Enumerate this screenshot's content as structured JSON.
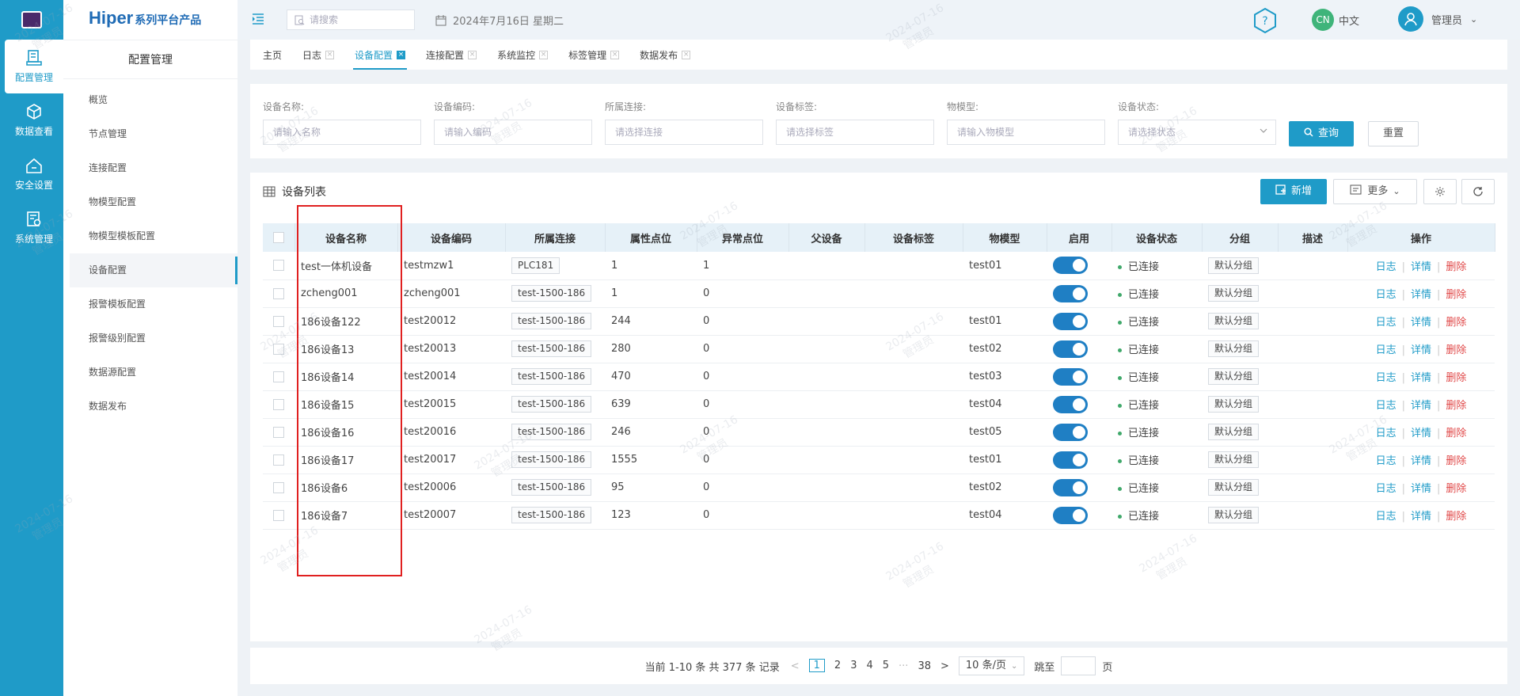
{
  "rail": {
    "items": [
      {
        "label": "配置管理",
        "icon": "device-config-icon"
      },
      {
        "label": "数据查看",
        "icon": "cube-icon"
      },
      {
        "label": "安全设置",
        "icon": "home-shield-icon"
      },
      {
        "label": "系统管理",
        "icon": "system-icon"
      }
    ]
  },
  "sidebar": {
    "brand_main": "Hiper",
    "brand_sub": "系列平台产品",
    "title": "配置管理",
    "items": [
      "概览",
      "节点管理",
      "连接配置",
      "物模型配置",
      "物模型模板配置",
      "设备配置",
      "报警模板配置",
      "报警级别配置",
      "数据源配置",
      "数据发布"
    ],
    "active": "设备配置"
  },
  "header": {
    "search_placeholder": "请搜索",
    "date": "2024年7月16日 星期二",
    "lang_badge": "CN",
    "lang_label": "中文",
    "user": "管理员"
  },
  "tabs": [
    {
      "label": "主页",
      "closable": false
    },
    {
      "label": "日志",
      "closable": true
    },
    {
      "label": "设备配置",
      "closable": true,
      "active": true
    },
    {
      "label": "连接配置",
      "closable": true
    },
    {
      "label": "系统监控",
      "closable": true
    },
    {
      "label": "标签管理",
      "closable": true
    },
    {
      "label": "数据发布",
      "closable": true
    }
  ],
  "filters": {
    "name": {
      "label": "设备名称:",
      "placeholder": "请输入名称"
    },
    "code": {
      "label": "设备编码:",
      "placeholder": "请输入编码"
    },
    "connection": {
      "label": "所属连接:",
      "placeholder": "请选择连接"
    },
    "tag": {
      "label": "设备标签:",
      "placeholder": "请选择标签"
    },
    "model": {
      "label": "物模型:",
      "placeholder": "请输入物模型"
    },
    "status": {
      "label": "设备状态:",
      "placeholder": "请选择状态"
    },
    "query": "查询",
    "reset": "重置"
  },
  "list": {
    "title": "设备列表",
    "new": "新增",
    "more": "更多",
    "columns": [
      "设备名称",
      "设备编码",
      "所属连接",
      "属性点位",
      "异常点位",
      "父设备",
      "设备标签",
      "物模型",
      "启用",
      "设备状态",
      "分组",
      "描述",
      "操作"
    ],
    "rows": [
      {
        "name": "test一体机设备",
        "code": "testmzw1",
        "conn": "PLC181",
        "points": "1",
        "errors": "1",
        "parent": "",
        "tag": "",
        "model": "test01",
        "status": "已连接",
        "group": "默认分组",
        "desc": ""
      },
      {
        "name": "zcheng001",
        "code": "zcheng001",
        "conn": "test-1500-186",
        "points": "1",
        "errors": "0",
        "parent": "",
        "tag": "",
        "model": "",
        "status": "已连接",
        "group": "默认分组",
        "desc": ""
      },
      {
        "name": "186设备122",
        "code": "test20012",
        "conn": "test-1500-186",
        "points": "244",
        "errors": "0",
        "parent": "",
        "tag": "",
        "model": "test01",
        "status": "已连接",
        "group": "默认分组",
        "desc": ""
      },
      {
        "name": "186设备13",
        "code": "test20013",
        "conn": "test-1500-186",
        "points": "280",
        "errors": "0",
        "parent": "",
        "tag": "",
        "model": "test02",
        "status": "已连接",
        "group": "默认分组",
        "desc": ""
      },
      {
        "name": "186设备14",
        "code": "test20014",
        "conn": "test-1500-186",
        "points": "470",
        "errors": "0",
        "parent": "",
        "tag": "",
        "model": "test03",
        "status": "已连接",
        "group": "默认分组",
        "desc": ""
      },
      {
        "name": "186设备15",
        "code": "test20015",
        "conn": "test-1500-186",
        "points": "639",
        "errors": "0",
        "parent": "",
        "tag": "",
        "model": "test04",
        "status": "已连接",
        "group": "默认分组",
        "desc": ""
      },
      {
        "name": "186设备16",
        "code": "test20016",
        "conn": "test-1500-186",
        "points": "246",
        "errors": "0",
        "parent": "",
        "tag": "",
        "model": "test05",
        "status": "已连接",
        "group": "默认分组",
        "desc": ""
      },
      {
        "name": "186设备17",
        "code": "test20017",
        "conn": "test-1500-186",
        "points": "1555",
        "errors": "0",
        "parent": "",
        "tag": "",
        "model": "test01",
        "status": "已连接",
        "group": "默认分组",
        "desc": ""
      },
      {
        "name": "186设备6",
        "code": "test20006",
        "conn": "test-1500-186",
        "points": "95",
        "errors": "0",
        "parent": "",
        "tag": "",
        "model": "test02",
        "status": "已连接",
        "group": "默认分组",
        "desc": ""
      },
      {
        "name": "186设备7",
        "code": "test20007",
        "conn": "test-1500-186",
        "points": "123",
        "errors": "0",
        "parent": "",
        "tag": "",
        "model": "test04",
        "status": "已连接",
        "group": "默认分组",
        "desc": ""
      }
    ],
    "actions": [
      "日志",
      "详情",
      "删除"
    ]
  },
  "pagination": {
    "summary": "当前 1-10 条 共 377 条 记录",
    "pages": [
      "1",
      "2",
      "3",
      "4",
      "5"
    ],
    "ellipsis": "···",
    "last": "38",
    "current": "1",
    "page_size": "10 条/页",
    "jump_label": "跳至",
    "page_unit": "页"
  },
  "watermark": {
    "date": "2024-07-16",
    "user": "管理员"
  },
  "colors": {
    "primary": "#1f9bc8",
    "danger": "#e04848",
    "success": "#3fa86a",
    "highlight": "#e02020"
  }
}
